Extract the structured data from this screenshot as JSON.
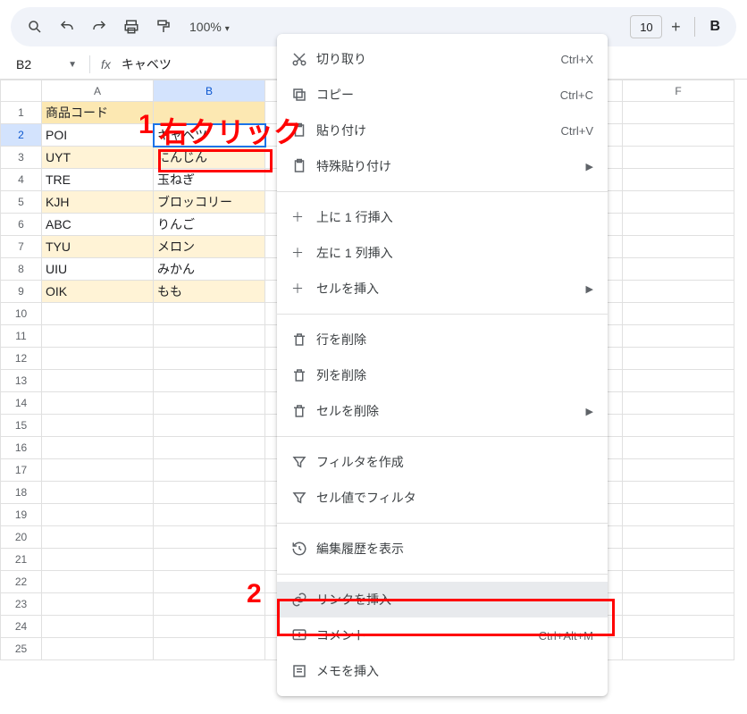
{
  "toolbar": {
    "zoom": "100%",
    "font_size": "10"
  },
  "namebox": "B2",
  "formula": "キャベツ",
  "columns": [
    "A",
    "B",
    "F"
  ],
  "row_count": 25,
  "selected_row": 2,
  "selected_col": "B",
  "headers": {
    "a": "商品コード"
  },
  "rows": [
    {
      "a": "POI",
      "b": "キャベツ",
      "band": false
    },
    {
      "a": "UYT",
      "b": "にんじん",
      "band": true
    },
    {
      "a": "TRE",
      "b": "玉ねぎ",
      "band": false
    },
    {
      "a": "KJH",
      "b": "ブロッコリー",
      "band": true
    },
    {
      "a": "ABC",
      "b": "りんご",
      "band": false
    },
    {
      "a": "TYU",
      "b": "メロン",
      "band": true
    },
    {
      "a": "UIU",
      "b": "みかん",
      "band": false
    },
    {
      "a": "OIK",
      "b": "もも",
      "band": true
    }
  ],
  "context_menu": {
    "cut": {
      "label": "切り取り",
      "shortcut": "Ctrl+X"
    },
    "copy": {
      "label": "コピー",
      "shortcut": "Ctrl+C"
    },
    "paste": {
      "label": "貼り付け",
      "shortcut": "Ctrl+V"
    },
    "paste_special": {
      "label": "特殊貼り付け"
    },
    "insert_row": {
      "label": "上に 1 行挿入"
    },
    "insert_col": {
      "label": "左に 1 列挿入"
    },
    "insert_cells": {
      "label": "セルを挿入"
    },
    "delete_row": {
      "label": "行を削除"
    },
    "delete_col": {
      "label": "列を削除"
    },
    "delete_cells": {
      "label": "セルを削除"
    },
    "create_filter": {
      "label": "フィルタを作成"
    },
    "filter_by_value": {
      "label": "セル値でフィルタ"
    },
    "edit_history": {
      "label": "編集履歴を表示"
    },
    "insert_link": {
      "label": "リンクを挿入"
    },
    "comment": {
      "label": "コメント",
      "shortcut": "Ctrl+Alt+M"
    },
    "insert_note": {
      "label": "メモを挿入"
    }
  },
  "annotations": {
    "num1": "1",
    "text1": "右クリック",
    "num2": "2"
  }
}
